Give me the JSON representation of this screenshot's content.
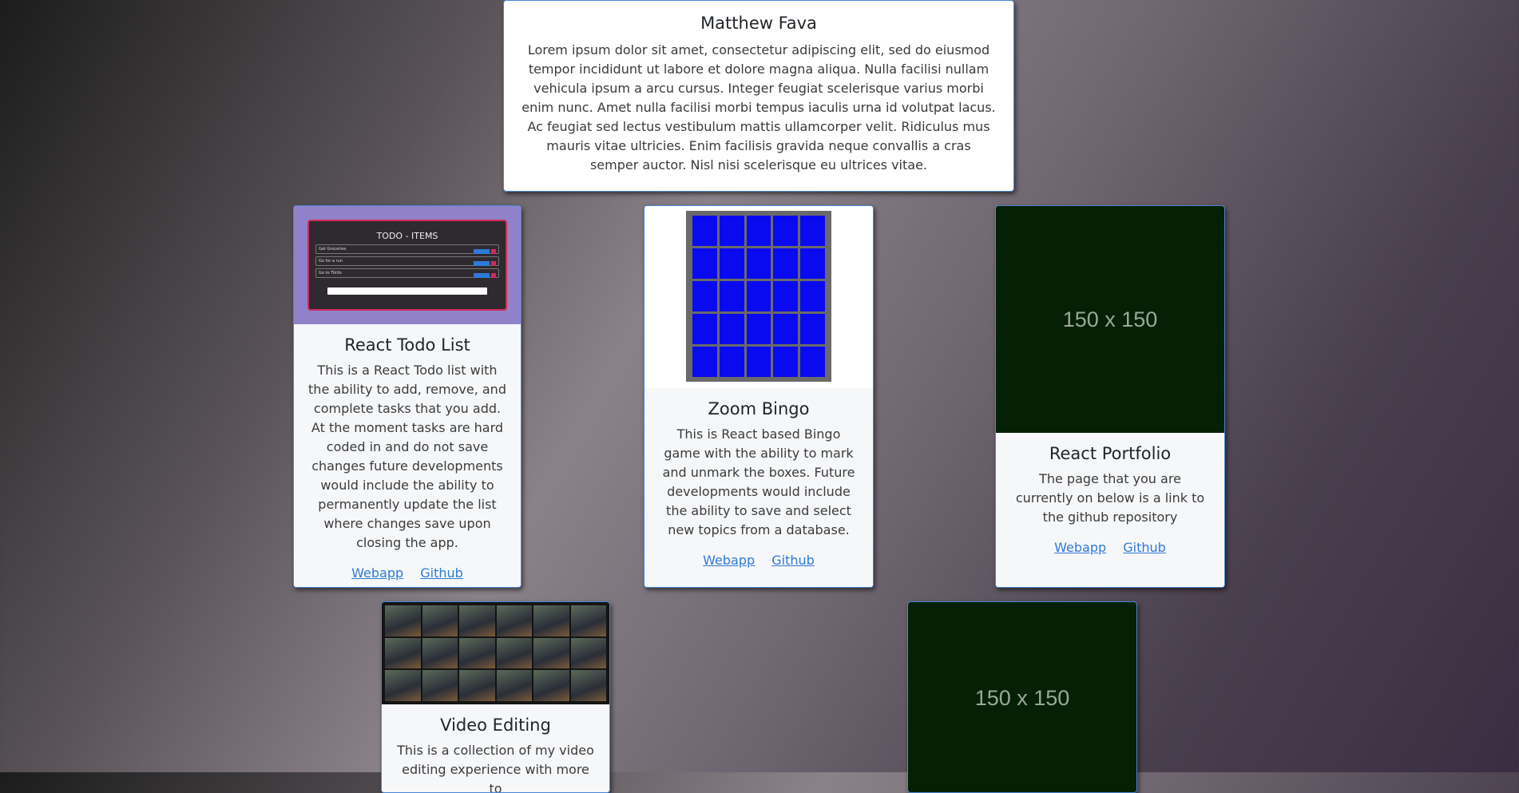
{
  "hero": {
    "name": "Matthew Fava",
    "bio": "Lorem ipsum dolor sit amet, consectetur adipiscing elit, sed do eiusmod tempor incididunt ut labore et dolore magna aliqua. Nulla facilisi nullam vehicula ipsum a arcu cursus. Integer feugiat scelerisque varius morbi enim nunc. Amet nulla facilisi morbi tempus iaculis urna id volutpat lacus. Ac feugiat sed lectus vestibulum mattis ullamcorper velit. Ridiculus mus mauris vitae ultricies. Enim facilisis gravida neque convallis a cras semper auctor. Nisl nisi scelerisque eu ultrices vitae."
  },
  "projects": [
    {
      "title": "React Todo List",
      "description": "This is a React Todo list with the ability to add, remove, and complete tasks that you add. At the moment tasks are hard coded in and do not save changes future developments would include the ability to permanently update the list where changes save upon closing the app.",
      "webapp": "Webapp",
      "github": "Github",
      "thumb_title": "TODO - ITEMS",
      "thumb_items": [
        "Get Groceries",
        "Go for a run",
        "Go to Tikito"
      ]
    },
    {
      "title": "Zoom Bingo",
      "description": "This is React based Bingo game with the ability to mark and unmark the boxes. Future developments would include the ability to save and select new topics from a database.",
      "webapp": "Webapp",
      "github": "Github"
    },
    {
      "title": "React Portfolio",
      "description": "The page that you are currently on below is a link to the github repository",
      "webapp": "Webapp",
      "github": "Github",
      "placeholder": "150 x 150"
    },
    {
      "title": "Video Editing",
      "description": "This is a collection of my video editing experience with more to",
      "webapp": "",
      "github": ""
    },
    {
      "placeholder": "150 x 150"
    }
  ]
}
